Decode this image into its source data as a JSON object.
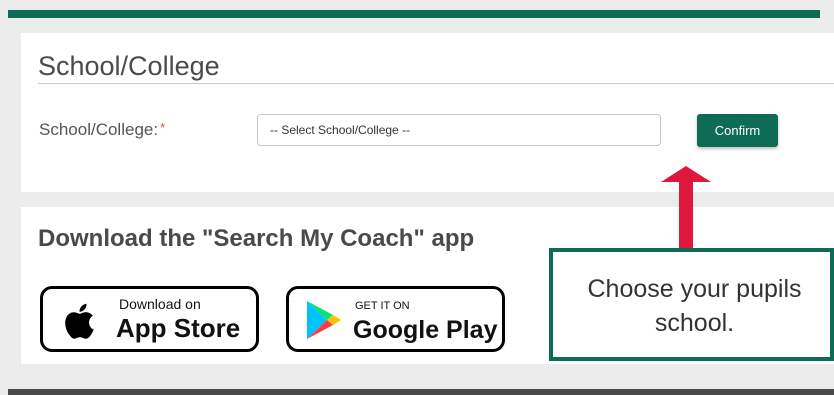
{
  "school_section": {
    "title": "School/College",
    "field_label": "School/College:",
    "required_mark": "*",
    "select_value": "-- Select School/College --",
    "confirm_label": "Confirm"
  },
  "download_section": {
    "title": "Download the \"Search My Coach\" app",
    "app_store": {
      "small": "Download on",
      "big": "App Store",
      "icon": "apple-logo-icon"
    },
    "google_play": {
      "small": "GET IT ON",
      "big": "Google Play",
      "icon": "google-play-icon"
    }
  },
  "tooltip": {
    "line1": "Choose your pupils",
    "line2": "school."
  },
  "colors": {
    "accent": "#0d6b56",
    "arrow": "#e0173c"
  }
}
